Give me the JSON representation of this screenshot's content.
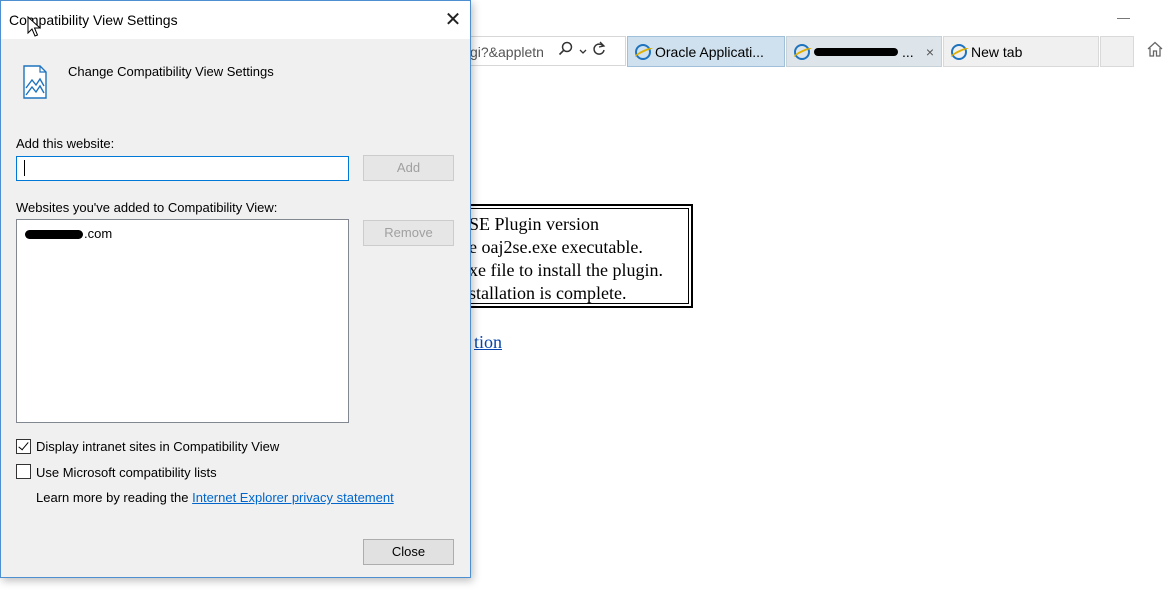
{
  "browser": {
    "address_text": "gi?&appletn",
    "tabs": [
      {
        "label": "Oracle Applicati..."
      },
      {
        "label": "...",
        "close": "×"
      },
      {
        "label": "New tab"
      }
    ],
    "page": {
      "notice_lines": [
        "SE Plugin version",
        "e oaj2se.exe executable.",
        "xe file to install the plugin.",
        "stallation is complete."
      ],
      "link_text": "tion"
    }
  },
  "dialog": {
    "title": "Compatibility View Settings",
    "header": "Change Compatibility View Settings",
    "add_label": "Add this website:",
    "add_input_value": "",
    "add_button": "Add",
    "list_label": "Websites you've added to Compatibility View:",
    "list_items": [
      ".com"
    ],
    "remove_button": "Remove",
    "options": [
      {
        "label": "Display intranet sites in Compatibility View",
        "checked": true
      },
      {
        "label": "Use Microsoft compatibility lists",
        "checked": false
      }
    ],
    "learn_more_prefix": "Learn more by reading the",
    "privacy_link": "Internet Explorer privacy statement",
    "close_button": "Close"
  },
  "icons": {
    "close": "close-icon",
    "search": "search-icon",
    "refresh": "refresh-icon",
    "home": "home-icon",
    "ie": "ie-icon",
    "header": "compatibility-icon"
  }
}
